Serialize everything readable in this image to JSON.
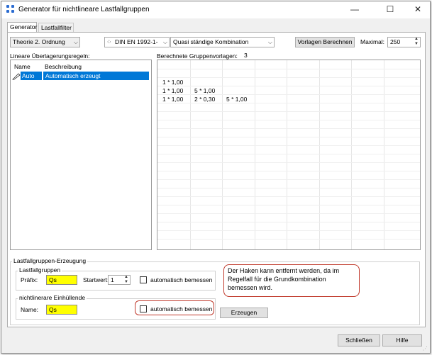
{
  "window": {
    "title": "Generator für nichtlineare Lastfallgruppen"
  },
  "title_controls": {
    "minimize": "—",
    "maximize": "☐",
    "close": "✕"
  },
  "tabs": [
    {
      "label": "Generator"
    },
    {
      "label": "Lastfallfilter"
    }
  ],
  "toolbar": {
    "analysis_type": "Theorie 2. Ordnung",
    "norm": "DIN EN 1992-1-",
    "combination": "Quasi ständige Kombination",
    "compute_button": "Vorlagen Berechnen",
    "max_label": "Maximal:",
    "max_value": "250"
  },
  "rules": {
    "header": "Lineare Überlagerungsregeln:",
    "columns": [
      "Name",
      "Beschreibung"
    ],
    "rows": [
      {
        "name": "Auto",
        "description": "Automatisch erzeugt"
      }
    ]
  },
  "templates": {
    "header": "Berechnete Gruppenvorlagen:",
    "count": "3",
    "rows": [
      [
        "1 * 1,00",
        "",
        ""
      ],
      [
        "1 * 1,00",
        "5 * 1,00",
        ""
      ],
      [
        "1 * 1,00",
        "2 * 0,30",
        "5 * 1,00"
      ]
    ]
  },
  "generation": {
    "title": "Lastfallgruppen-Erzeugung",
    "lcg_group": "Lastfallgruppen",
    "prefix_label": "Präfix:",
    "prefix_value": "Qs",
    "start_label": "Startwert:",
    "start_value": "1",
    "auto_design_label": "automatisch bemessen",
    "envelope_group": "nichtlinerare Einhüllende",
    "name_label": "Name:",
    "name_value": "Qs",
    "envelope_design_label": "automatisch bemessen",
    "create_button": "Erzeugen"
  },
  "callout": {
    "text": "Der Haken kann entfernt werden, da im Regelfall für die Grundkombination bemessen wird."
  },
  "footer": {
    "close_button": "Schließen",
    "help_button": "Hilfe"
  },
  "colors": {
    "selection": "#0078d7",
    "highlight_field": "#ffff00",
    "annotation": "#c0392b"
  }
}
